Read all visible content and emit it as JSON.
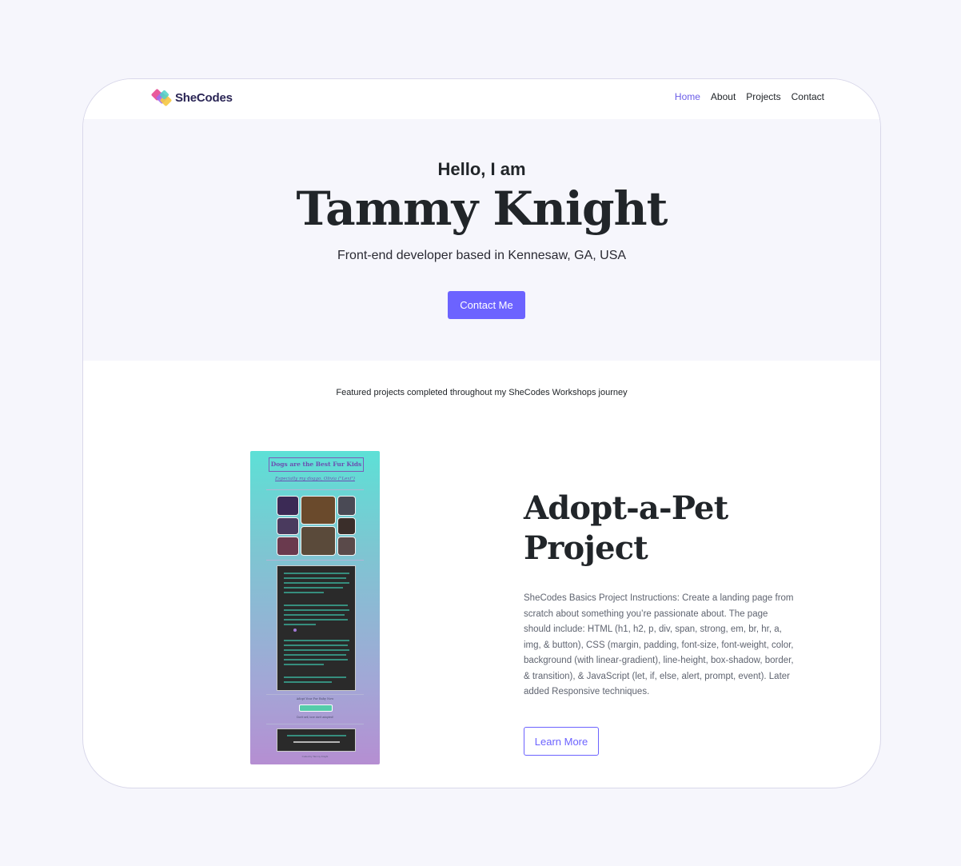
{
  "nav": {
    "logo_text": "SheCodes",
    "links": [
      "Home",
      "About",
      "Projects",
      "Contact"
    ],
    "active": "Home"
  },
  "hero": {
    "greeting": "Hello, I am",
    "name": "Tammy Knight",
    "subtitle": "Front-end developer based in Kennesaw, GA, USA",
    "button_label": "Contact Me"
  },
  "featured": {
    "intro": "Featured projects completed throughout my SheCodes Workshops journey"
  },
  "project": {
    "title": "Adopt-a-Pet Project",
    "description": "SheCodes Basics Project Instructions: Create a landing page from scratch about something you’re passionate about. The page should include: HTML (h1, h2, p, div, span, strong, em, br, hr, a, img, & button), CSS (margin, padding, font-size, font-weight, color, background (with linear-gradient), line-height, box-shadow, border, & transition), & JavaScript (let, if, else, alert, prompt, event). Later added Responsive techniques.",
    "button_label": "Learn More",
    "thumbnail": {
      "title": "Dogs are the Best Fur Kids",
      "subtitle": "Especially my doggo, Olivia (\"Lexi\")",
      "adopt_text": "Adopt Your Fur Baby Now",
      "ack_text": "Don't sell, love don't adopted!",
      "footer": "Coded by Tammy Knight"
    }
  },
  "colors": {
    "accent": "#6c63ff",
    "hero_bg": "#f6f6fc",
    "page_bg": "#f6f6fc",
    "text_dark": "#212529"
  }
}
